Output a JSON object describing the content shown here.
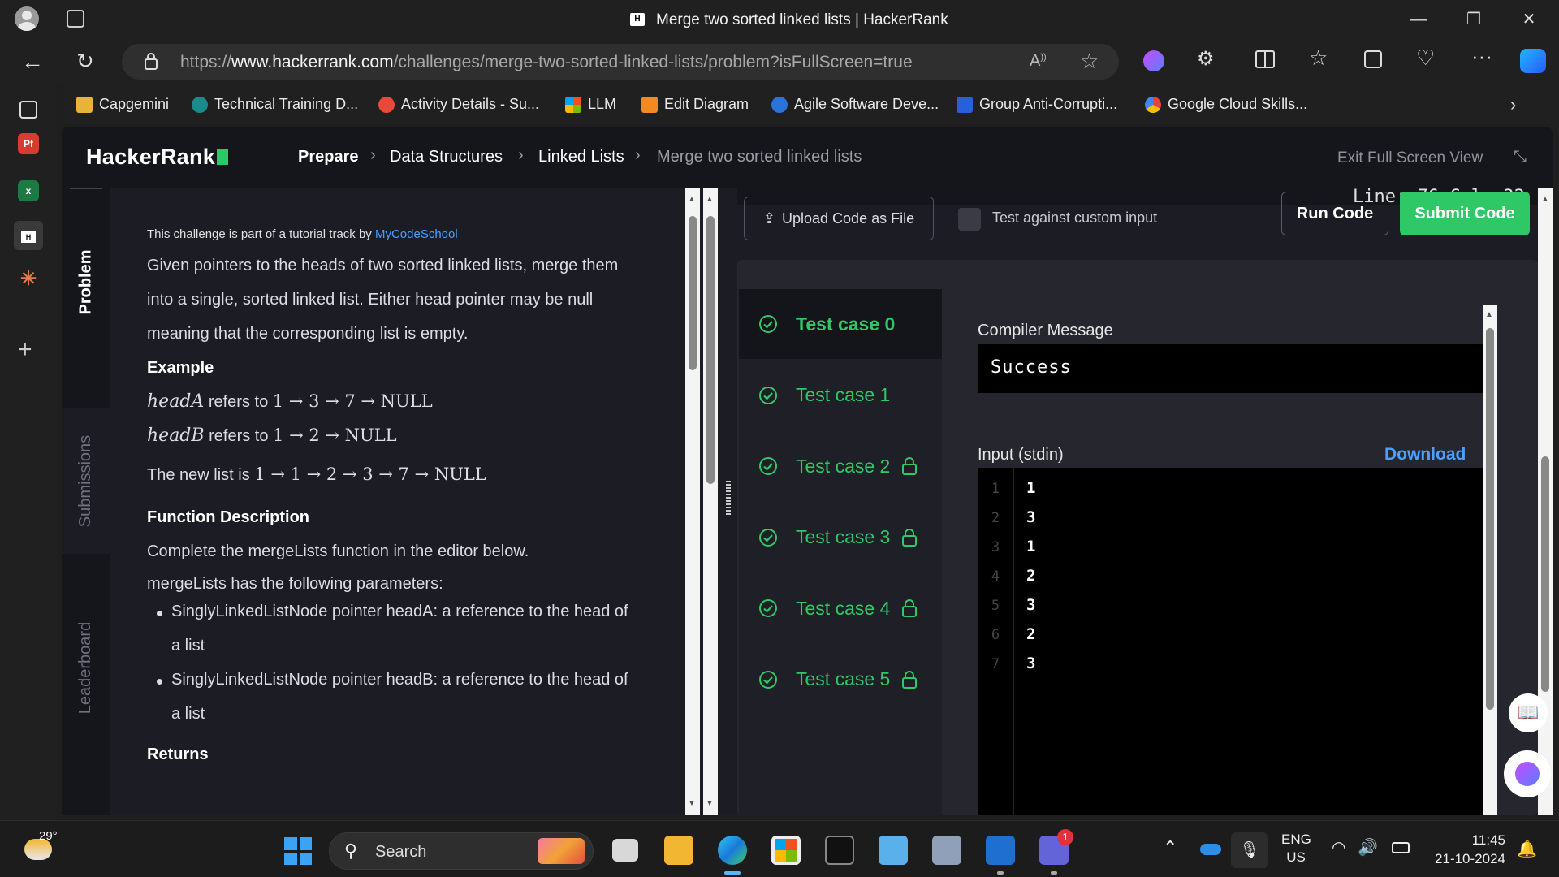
{
  "browser": {
    "tab_title": "Merge two sorted linked lists | HackerRank",
    "url_prefix": "https://",
    "url_domain": "www.hackerrank.com",
    "url_path": "/challenges/merge-two-sorted-linked-lists/problem?isFullScreen=true",
    "bookmarks": [
      "Capgemini",
      "Technical Training D...",
      "Activity Details - Su...",
      "LLM",
      "Edit Diagram",
      "Agile Software Deve...",
      "Group Anti-Corrupti...",
      "Google Cloud Skills..."
    ]
  },
  "header": {
    "logo": "HackerRank",
    "breadcrumbs": [
      "Prepare",
      "Data Structures",
      "Linked Lists",
      "Merge two sorted linked lists"
    ],
    "exit_fullscreen": "Exit Full Screen View"
  },
  "vtabs": [
    "Problem",
    "Submissions",
    "Leaderboard"
  ],
  "problem": {
    "track_prefix": "This challenge is part of a tutorial track by",
    "track_link": "MyCodeSchool",
    "intro_lines": [
      "Given pointers to the heads of two sorted linked lists, merge them",
      "into a single, sorted linked list. Either head pointer may be null",
      "meaning that the corresponding list is empty."
    ],
    "example_heading": "Example",
    "headA_name": "headA",
    "refers_to": "refers to",
    "headA_expr": "1 → 3 → 7 → NULL",
    "headB_name": "headB",
    "headB_expr": "1 → 2 → NULL",
    "new_list_prefix": "The new list is",
    "new_list_expr": "1 → 1 → 2 → 3 → 7 → NULL",
    "function_heading": "Function Description",
    "function_text": "Complete the mergeLists function in the editor below.",
    "params_text": "mergeLists has the following parameters:",
    "param1_line1": "SinglyLinkedListNode pointer headA: a reference to the head of",
    "param1_line2": "a list",
    "param2_line1": "SinglyLinkedListNode pointer headB: a reference to the head of",
    "param2_line2": "a list",
    "returns_heading": "Returns"
  },
  "editor": {
    "cursor_status": "Line: 76 Col: 22",
    "upload_button": "Upload Code as File",
    "custom_input_label": "Test against custom input",
    "run_button": "Run Code",
    "submit_button": "Submit Code"
  },
  "results": {
    "test_cases": [
      {
        "label": "Test case 0",
        "locked": false,
        "passed": true
      },
      {
        "label": "Test case 1",
        "locked": false,
        "passed": true
      },
      {
        "label": "Test case 2",
        "locked": true,
        "passed": true
      },
      {
        "label": "Test case 3",
        "locked": true,
        "passed": true
      },
      {
        "label": "Test case 4",
        "locked": true,
        "passed": true
      },
      {
        "label": "Test case 5",
        "locked": true,
        "passed": true
      }
    ],
    "compiler_label": "Compiler Message",
    "compiler_message": "Success",
    "stdin_label": "Input (stdin)",
    "download_label": "Download",
    "stdin_lines": [
      {
        "n": "1",
        "v": "1"
      },
      {
        "n": "2",
        "v": "3"
      },
      {
        "n": "3",
        "v": "1"
      },
      {
        "n": "4",
        "v": "2"
      },
      {
        "n": "5",
        "v": "3"
      },
      {
        "n": "6",
        "v": "2"
      },
      {
        "n": "7",
        "v": "3"
      }
    ]
  },
  "taskbar": {
    "weather_temp": "29°",
    "search_placeholder": "Search",
    "lang_line1": "ENG",
    "lang_line2": "US",
    "time": "11:45",
    "date": "21-10-2024",
    "teams_badge": "1"
  },
  "colors": {
    "accent_green": "#2ec866",
    "link_blue": "#4aa0ff"
  }
}
